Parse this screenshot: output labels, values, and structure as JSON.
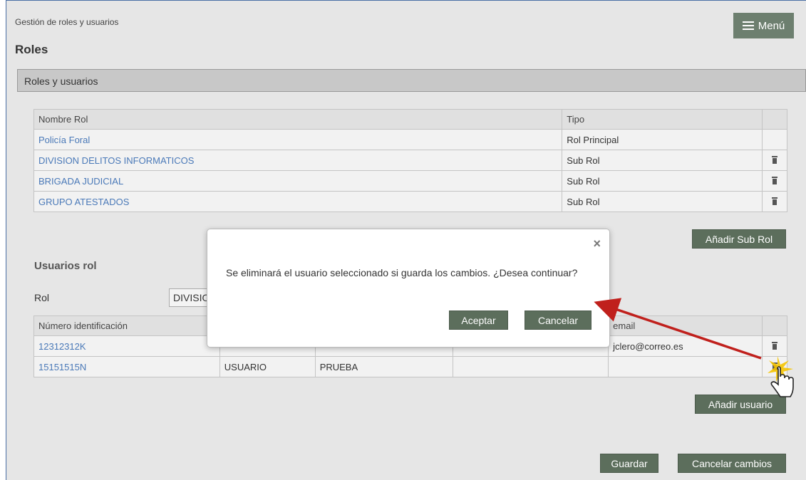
{
  "header": {
    "breadcrumb": "Gestión de roles y usuarios",
    "title": "Roles",
    "menu_label": "Menú"
  },
  "section": {
    "title": "Roles y usuarios"
  },
  "roles_table": {
    "headers": [
      "Nombre Rol",
      "Tipo",
      ""
    ],
    "rows": [
      {
        "name": "Policía Foral",
        "type": "Rol Principal",
        "deletable": false
      },
      {
        "name": "DIVISION DELITOS INFORMATICOS",
        "type": "Sub Rol",
        "deletable": true
      },
      {
        "name": "BRIGADA JUDICIAL",
        "type": "Sub Rol",
        "deletable": true
      },
      {
        "name": "GRUPO ATESTADOS",
        "type": "Sub Rol",
        "deletable": true
      }
    ]
  },
  "add_subrol_label": "Añadir Sub Rol",
  "users": {
    "title": "Usuarios rol",
    "rol_label": "Rol",
    "rol_selected": "DIVISION DELITOS INFORMATICOS",
    "headers": [
      "Número identificación",
      "",
      "",
      "",
      "email",
      ""
    ],
    "rows": [
      {
        "id": "12312312K",
        "col2": "",
        "col3": "",
        "col4": "",
        "email": "jclero@correo.es"
      },
      {
        "id": "15151515N",
        "col2": "USUARIO",
        "col3": "PRUEBA",
        "col4": "",
        "email": ""
      }
    ],
    "add_label": "Añadir usuario"
  },
  "footer": {
    "save_label": "Guardar",
    "cancel_label": "Cancelar cambios"
  },
  "modal": {
    "close_glyph": "×",
    "message": "Se eliminará el usuario seleccionado si guarda los cambios. ¿Desea continuar?",
    "accept_label": "Aceptar",
    "cancel_label": "Cancelar"
  },
  "colors": {
    "accent": "#5c6e5c",
    "link": "#4a79b8",
    "arrow": "#c0201c",
    "highlight": "#f5c400"
  },
  "icons": [
    "menu-icon",
    "trash-icon",
    "close-icon",
    "pointer-hand-icon"
  ]
}
